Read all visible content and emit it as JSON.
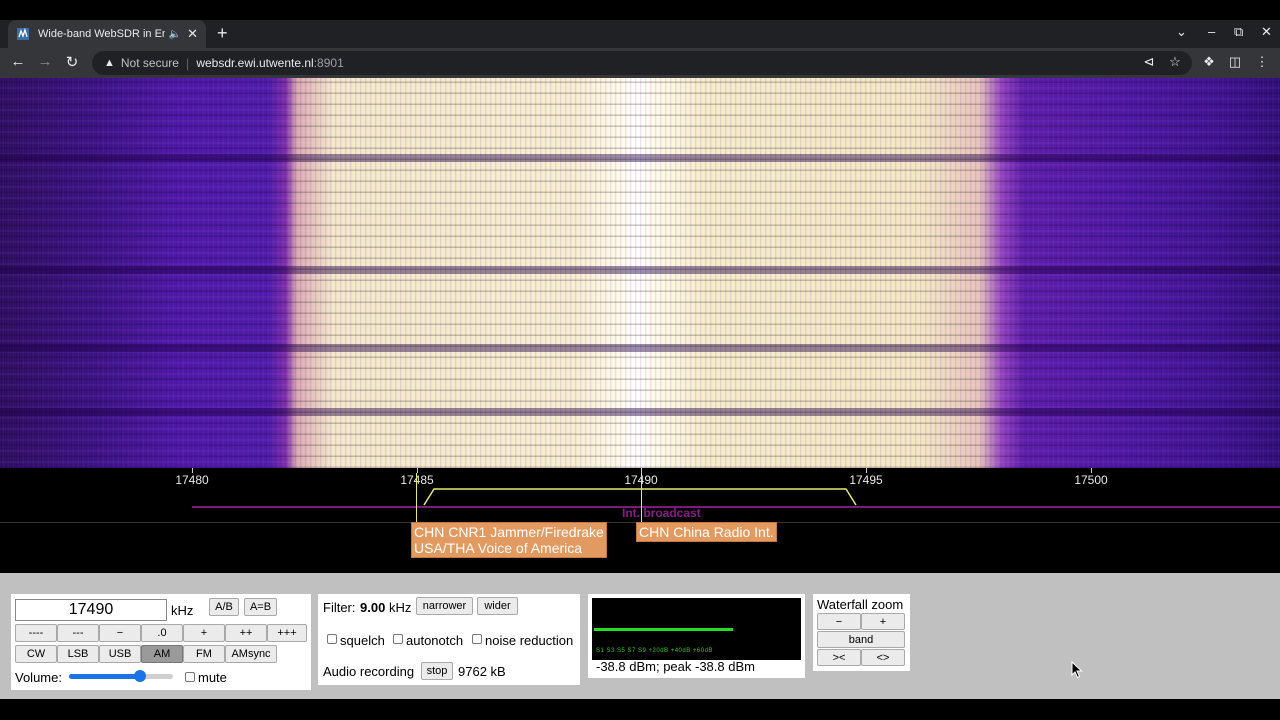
{
  "browser": {
    "tab_title": "Wide-band WebSDR in Ensch",
    "url_security": "Not secure",
    "url_host": "websdr.ewi.utwente.nl",
    "url_port": ":8901"
  },
  "scale": {
    "ticks": [
      {
        "label": "17480"
      },
      {
        "label": "17485"
      },
      {
        "label": "17490"
      },
      {
        "label": "17495"
      },
      {
        "label": "17500"
      }
    ],
    "band_label": "Int. broadcast"
  },
  "stations": {
    "left_line1": "CHN CNR1 Jammer/Firedrake",
    "left_line2": "USA/THA Voice of America",
    "right": "CHN China Radio Int."
  },
  "tuning": {
    "frequency": "17490",
    "unit": "kHz",
    "ab": "A/B",
    "a_eq_b": "A=B",
    "steps": [
      "----",
      "---",
      "−",
      ".0",
      "+",
      "++",
      "+++"
    ],
    "modes": [
      "CW",
      "LSB",
      "USB",
      "AM",
      "FM",
      "AMsync"
    ],
    "active_mode": "AM",
    "volume_label": "Volume:",
    "volume_level": 0.68,
    "mute_label": "mute"
  },
  "filter": {
    "label": "Filter:",
    "value": "9.00",
    "unit": "kHz",
    "narrower": "narrower",
    "wider": "wider",
    "squelch": "squelch",
    "autonotch": "autonotch",
    "noise_reduction": "noise reduction",
    "recording_label": "Audio recording",
    "stop": "stop",
    "recording_size": "9762 kB"
  },
  "smeter": {
    "level_text": "-38.8 dBm; peak  -38.8 dBm",
    "scale_labels": "S1   S3   S5   S7   S9   +20dB  +40dB  +60dB",
    "signal_fraction": 0.68,
    "bar_color": "#22dd22"
  },
  "zoom": {
    "title": "Waterfall zoom",
    "minus": "−",
    "plus": "+",
    "band": "band",
    "narrow": "><",
    "wide": "<>"
  },
  "colors": {
    "waterfall_core": "#ffffff",
    "waterfall_edge": "#4b14a5",
    "station_label_bg": "#e39a60",
    "passband": "#e8e870"
  }
}
